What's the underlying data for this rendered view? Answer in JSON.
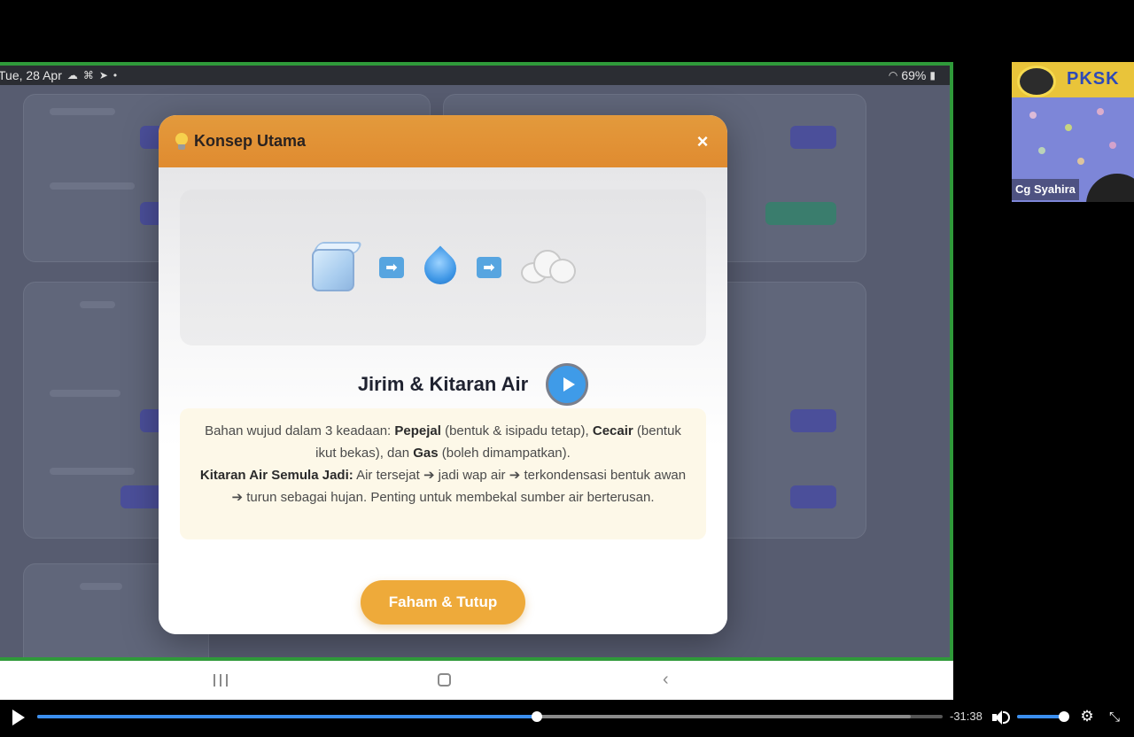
{
  "statusbar": {
    "date": "Tue, 28 Apr",
    "battery": "69%"
  },
  "modal": {
    "title": "Konsep Utama",
    "close_label": "×",
    "topic_title": "Jirim & Kitaran Air",
    "description_parts": {
      "p1_a": "Bahan wujud dalam 3 keadaan: ",
      "p1_b": "Pepejal",
      "p1_c": " (bentuk & isipadu tetap), ",
      "p1_d": "Cecair",
      "p1_e": " (bentuk ikut bekas), dan ",
      "p1_f": "Gas",
      "p1_g": " (boleh dimampatkan).",
      "p2_a": "Kitaran Air Semula Jadi:",
      "p2_b": " Air tersejat ➔ jadi wap air ➔ terkondensasi bentuk awan ➔ turun sebagai hujan. Penting untuk membekal sumber air berterusan."
    },
    "button_label": "Faham & Tutup",
    "arrow_glyph": "➡"
  },
  "webcam": {
    "logo_text": "PKSK",
    "participant_name": "Cg Syahira"
  },
  "player": {
    "time_remaining": "-31:38",
    "progress_fraction": 0.552,
    "volume_fraction": 0.95
  },
  "colors": {
    "modal_header": "#e08b30",
    "primary_button": "#eeaa3a",
    "screen_border": "#2f9a3a",
    "progress": "#3b8ff0"
  }
}
